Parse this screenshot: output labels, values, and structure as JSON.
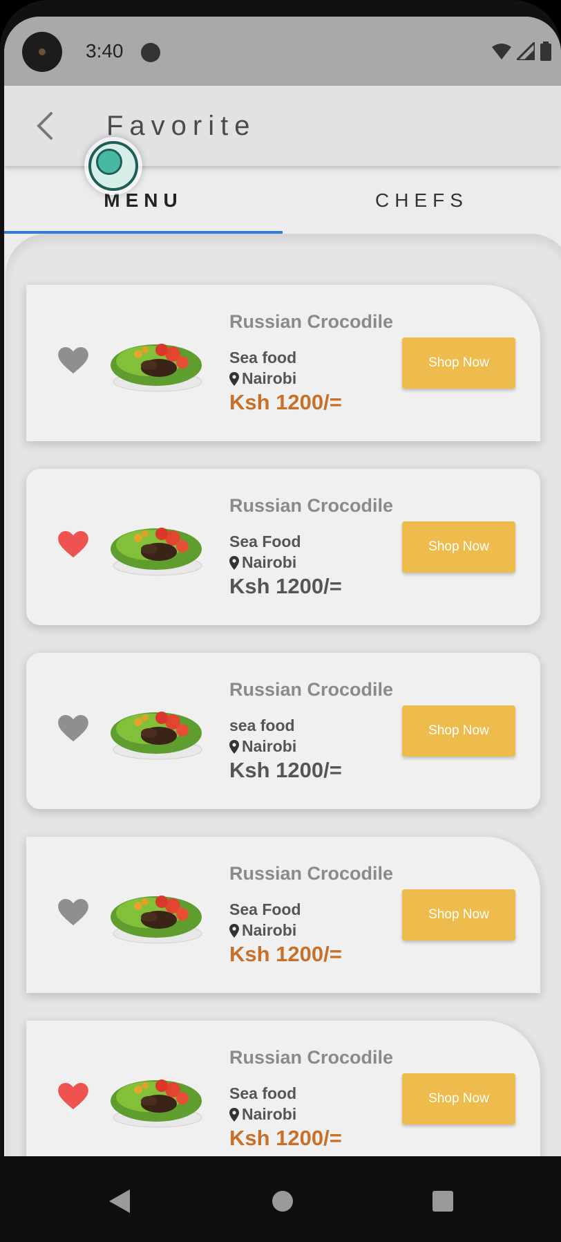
{
  "status_bar": {
    "time": "3:40"
  },
  "app_bar": {
    "title": "Favorite"
  },
  "tabs": [
    {
      "label": "MENU",
      "selected": true
    },
    {
      "label": "CHEFS",
      "selected": false
    }
  ],
  "colors": {
    "accent": "#2f7fd6",
    "button": "#eebc4d",
    "price_highlight": "#c7702a",
    "price_default": "#555555",
    "heart_active": "#ef5350",
    "heart_inactive": "#8f8f8f"
  },
  "cards": [
    {
      "name": "Russian Crocodile",
      "category": "Sea food",
      "location": "Nairobi",
      "price": "Ksh 1200/=",
      "favorited": false,
      "button": "Shop Now"
    },
    {
      "name": "Russian Crocodile",
      "category": "Sea Food",
      "location": "Nairobi",
      "price": "Ksh 1200/=",
      "favorited": true,
      "button": "Shop Now"
    },
    {
      "name": "Russian Crocodile",
      "category": "sea food",
      "location": "Nairobi",
      "price": "Ksh 1200/=",
      "favorited": false,
      "button": "Shop Now"
    },
    {
      "name": "Russian Crocodile",
      "category": "Sea Food",
      "location": "Nairobi",
      "price": "Ksh 1200/=",
      "favorited": false,
      "button": "Shop Now"
    },
    {
      "name": "Russian Crocodile",
      "category": "Sea food",
      "location": "Nairobi",
      "price": "Ksh 1200/=",
      "favorited": true,
      "button": "Shop Now"
    }
  ]
}
